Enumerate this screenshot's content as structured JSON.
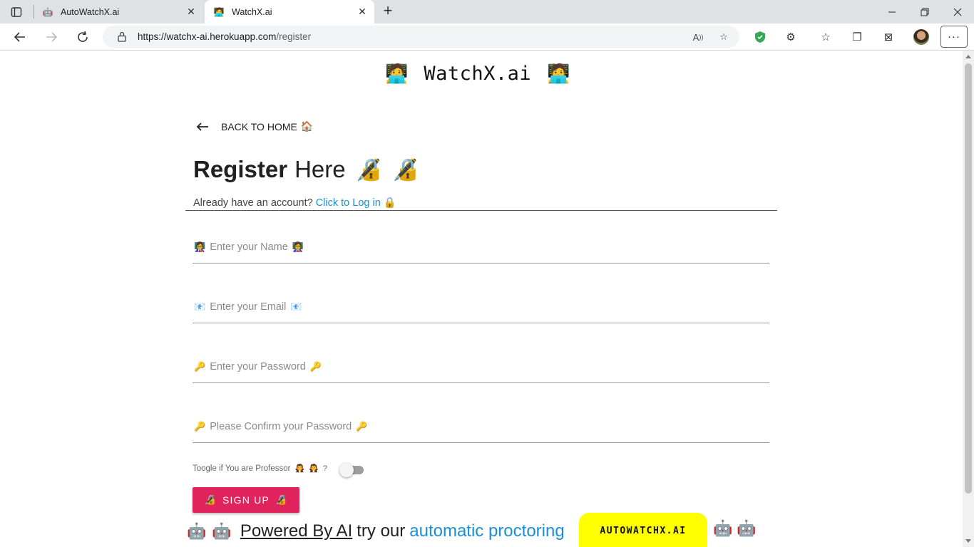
{
  "browser": {
    "tabs": [
      {
        "title": "AutoWatchX.ai",
        "icon": "robot-favicon-icon"
      },
      {
        "title": "WatchX.ai",
        "icon": "person-laptop-favicon-icon"
      }
    ],
    "url_main": "https://watchx-ai.herokuapp.com",
    "url_path": "/register"
  },
  "page": {
    "brand_emoji": "🧑‍💻",
    "brand_name": "WatchX.ai",
    "back_label": "BACK TO HOME",
    "back_emoji": "🏠",
    "title_bold": "Register",
    "title_rest": "Here",
    "title_emoji": "🔏",
    "subtitle_text": "Already have an account?",
    "subtitle_link": "Click to Log in",
    "subtitle_emoji": "🔒",
    "fields": [
      {
        "emoji": "👩‍🏫",
        "placeholder": "Enter your Name"
      },
      {
        "emoji": "📧",
        "placeholder": "Enter your Email"
      },
      {
        "emoji": "🔑",
        "placeholder": "Enter your Password"
      },
      {
        "emoji": "🔑",
        "placeholder": "Please Confirm your Password"
      }
    ],
    "toggle_label": "Toogle if You are Professor",
    "toggle_emoji": "🧛",
    "toggle_suffix": "?",
    "toggle_on": false,
    "signup_label": "SIGN UP",
    "signup_emoji": "🔏",
    "footer_emoji": "🤖",
    "footer_powered": "Powered By AI",
    "footer_try": "try our",
    "footer_link": "automatic proctoring",
    "auto_button": "AUTOWATCHX.AI"
  },
  "colors": {
    "accent": "#e0235d",
    "link": "#1a8fd8",
    "auto_button": "#ffff00"
  }
}
